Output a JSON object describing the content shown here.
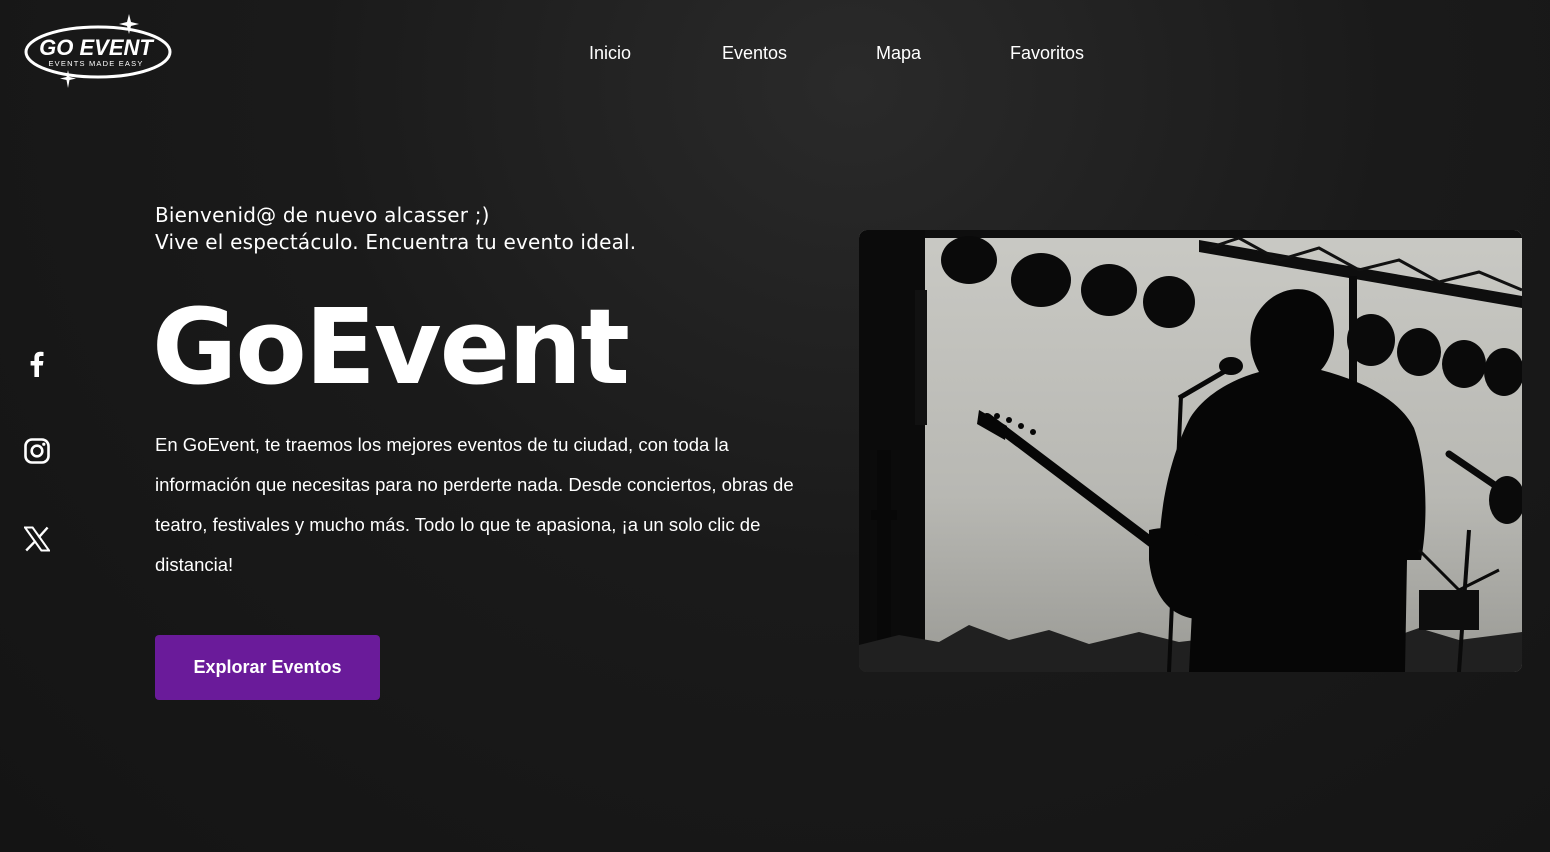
{
  "header": {
    "logo": {
      "primary": "GO EVENT",
      "tagline": "EVENTS MADE EASY"
    },
    "nav": [
      {
        "label": "Inicio"
      },
      {
        "label": "Eventos"
      },
      {
        "label": "Mapa"
      },
      {
        "label": "Favoritos"
      }
    ]
  },
  "social": [
    {
      "icon": "facebook-icon"
    },
    {
      "icon": "instagram-icon"
    },
    {
      "icon": "x-icon"
    }
  ],
  "hero": {
    "greeting": "Bienvenid@ de nuevo alcasser ;)",
    "subtitle": "Vive el espectáculo. Encuentra tu evento ideal.",
    "title": "GoEvent",
    "description": "En GoEvent, te traemos los mejores eventos de tu ciudad, con toda la información que necesitas para no perderte nada. Desde conciertos, obras de teatro, festivales y mucho más. Todo lo que te apasiona, ¡a un solo clic de distancia!",
    "cta_label": "Explorar Eventos",
    "image": "guitarist-silhouette-stage-photo"
  },
  "colors": {
    "background": "#151515",
    "accent": "#6a1b9a",
    "text": "#ffffff"
  }
}
